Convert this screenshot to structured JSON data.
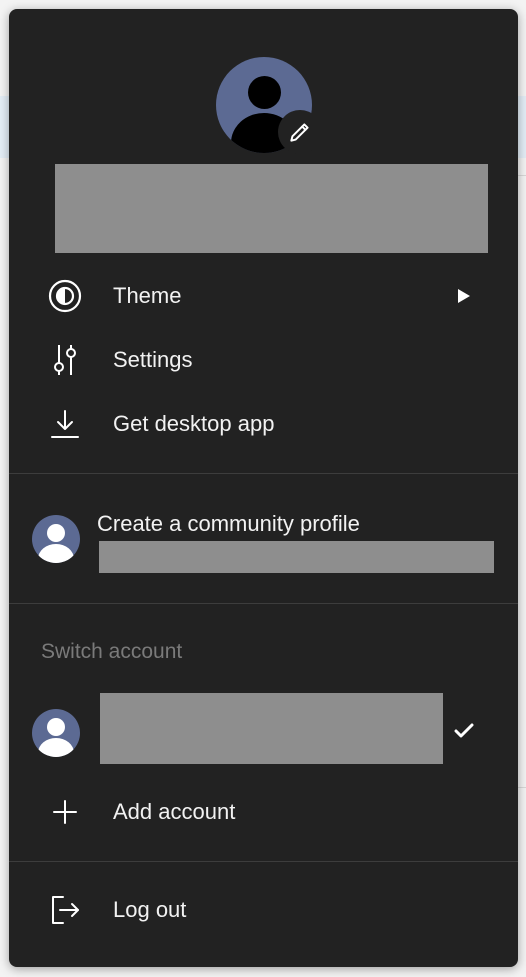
{
  "menu": {
    "items": [
      {
        "label": "Theme",
        "icon": "theme-icon"
      },
      {
        "label": "Settings",
        "icon": "sliders-icon"
      },
      {
        "label": "Get desktop app",
        "icon": "download-icon"
      }
    ],
    "community": {
      "title": "Create a community profile"
    },
    "switch_account": {
      "section_title": "Switch account",
      "add_label": "Add account"
    },
    "logout_label": "Log out"
  },
  "colors": {
    "panel": "#222222",
    "avatar": "#5c6a93",
    "redaction": "#8e8e8e"
  }
}
